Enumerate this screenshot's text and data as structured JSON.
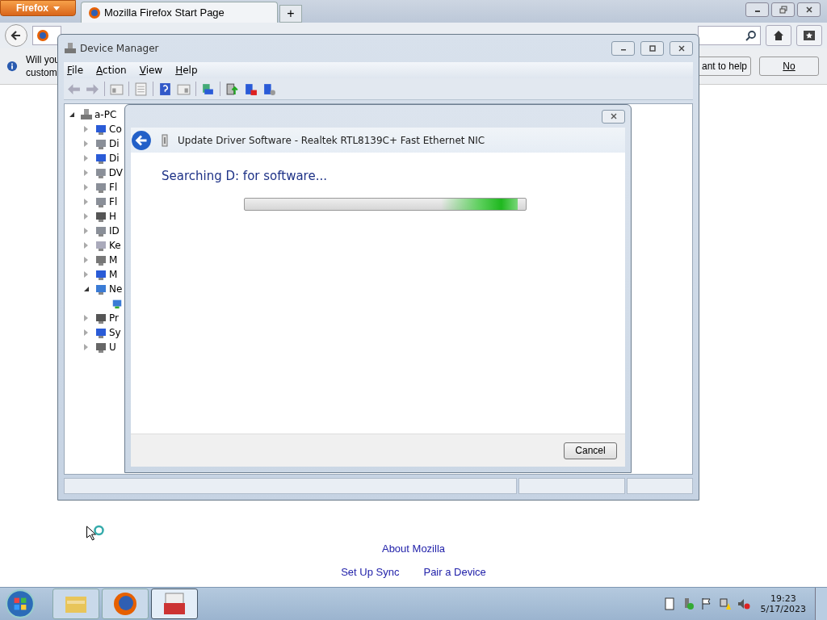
{
  "browser": {
    "menu_button": "Firefox",
    "tabs": [
      {
        "title": "Mozilla Firefox Start Page",
        "selected": true
      }
    ],
    "new_tab": "+",
    "notification": {
      "line_1": "Will you",
      "line_2": "custom",
      "help_button": "ant to help",
      "no_button": "No"
    },
    "link_rows": [
      [
        {
          "label": "About Mozilla"
        }
      ],
      [
        {
          "label": "Set Up Sync"
        },
        {
          "label": "Pair a Device"
        }
      ]
    ]
  },
  "device_manager": {
    "title": "Device Manager",
    "menu": [
      "File",
      "Action",
      "View",
      "Help"
    ],
    "tree": {
      "label": "a-PC",
      "expanded": true,
      "children": [
        {
          "label": "Co",
          "kind": "monitor",
          "expanded": false
        },
        {
          "label": "Di",
          "kind": "drive",
          "expanded": false
        },
        {
          "label": "Di",
          "kind": "monitor",
          "expanded": false
        },
        {
          "label": "DV",
          "kind": "drive",
          "expanded": false
        },
        {
          "label": "Fl",
          "kind": "drive",
          "expanded": false
        },
        {
          "label": "Fl",
          "kind": "drive",
          "expanded": false
        },
        {
          "label": "H",
          "kind": "chip",
          "expanded": false
        },
        {
          "label": "ID",
          "kind": "drive",
          "expanded": false
        },
        {
          "label": "Ke",
          "kind": "keyboard",
          "expanded": false
        },
        {
          "label": "M",
          "kind": "mouse",
          "expanded": false
        },
        {
          "label": "M",
          "kind": "monitor",
          "expanded": false
        },
        {
          "label": "Ne",
          "kind": "network",
          "expanded": true,
          "children": [
            {
              "kind": "network"
            }
          ]
        },
        {
          "label": "Pr",
          "kind": "chip",
          "expanded": false
        },
        {
          "label": "Sy",
          "kind": "monitor",
          "expanded": false
        },
        {
          "label": "U",
          "kind": "usb",
          "expanded": false
        }
      ]
    }
  },
  "dialog": {
    "title": "Update Driver Software - Realtek RTL8139C+ Fast Ethernet NIC",
    "heading": "Searching D: for software...",
    "progress": {
      "level": 0.97
    },
    "cancel_button": "Cancel"
  },
  "taskbar": {
    "apps": [
      {
        "kind": "folder",
        "selected": false
      },
      {
        "kind": "firefox",
        "selected": false
      },
      {
        "kind": "toolbox",
        "selected": true
      }
    ],
    "time": "19:23",
    "date": "5/17/2023"
  }
}
